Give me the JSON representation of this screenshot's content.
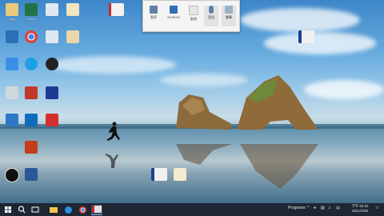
{
  "recorder": {
    "pause_label": "暫停",
    "time": "00:00:04",
    "stop_label": "停止",
    "cancel_label": "取消",
    "mic_label": "音訊",
    "pen_label": "畫筆"
  },
  "taskbar": {
    "programs_label": "Programs",
    "ime_label": "中",
    "time": "下午 02:21",
    "date": "2021/3/30"
  },
  "colors": {
    "taskbar_bg": "#1e2633",
    "accent": "#2f7bd6"
  }
}
